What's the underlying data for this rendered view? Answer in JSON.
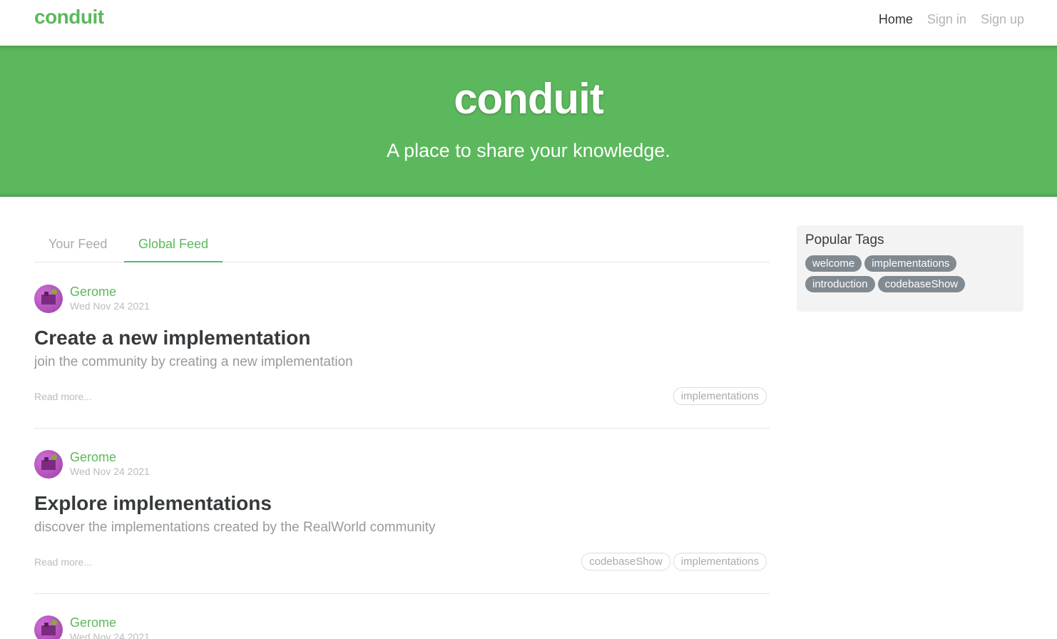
{
  "navbar": {
    "brand": "conduit",
    "links": [
      {
        "label": "Home",
        "active": true
      },
      {
        "label": "Sign in",
        "active": false
      },
      {
        "label": "Sign up",
        "active": false
      }
    ]
  },
  "banner": {
    "title": "conduit",
    "subtitle": "A place to share your knowledge."
  },
  "feed": {
    "tabs": [
      {
        "label": "Your Feed",
        "active": false
      },
      {
        "label": "Global Feed",
        "active": true
      }
    ]
  },
  "articles": [
    {
      "author": "Gerome",
      "date": "Wed Nov 24 2021",
      "title": "Create a new implementation",
      "description": "join the community by creating a new implementation",
      "read_more": "Read more...",
      "tags": [
        "implementations"
      ]
    },
    {
      "author": "Gerome",
      "date": "Wed Nov 24 2021",
      "title": "Explore implementations",
      "description": "discover the implementations created by the RealWorld community",
      "read_more": "Read more...",
      "tags": [
        "codebaseShow",
        "implementations"
      ]
    },
    {
      "author": "Gerome",
      "date": "Wed Nov 24 2021"
    }
  ],
  "sidebar": {
    "title": "Popular Tags",
    "tags": [
      "welcome",
      "implementations",
      "introduction",
      "codebaseShow"
    ]
  },
  "colors": {
    "brand": "#5cb85c",
    "tag_pill": "#818a91"
  }
}
